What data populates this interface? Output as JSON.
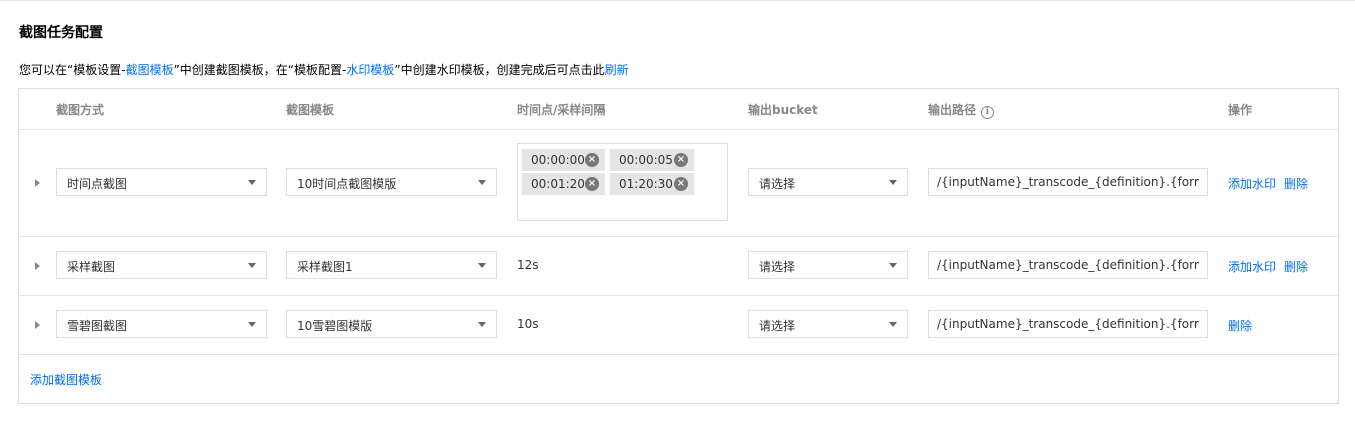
{
  "section": {
    "title": "截图任务配置"
  },
  "hint": {
    "p1": "您可以在“模板设置-",
    "link1": "截图模板",
    "p2": "”中创建截图模板，在“模板配置-",
    "link2": "水印模板",
    "p3": "”中创建水印模板，创建完成后可点击此",
    "refresh": "刷新"
  },
  "columns": {
    "method": "截图方式",
    "template": "截图模板",
    "interval": "时间点/采样间隔",
    "bucket": "输出bucket",
    "path": "输出路径",
    "actions": "操作"
  },
  "rows": [
    {
      "method": "时间点截图",
      "template": "10时间点截图模版",
      "tags": [
        "00:00:00",
        "00:00:05",
        "00:01:20",
        "01:20:30"
      ],
      "bucket": "请选择",
      "path": "/{inputName}_transcode_{definition}.{format}",
      "watermark": "添加水印",
      "delete": "删除"
    },
    {
      "method": "采样截图",
      "template": "采样截图1",
      "interval": "12s",
      "bucket": "请选择",
      "path": "/{inputName}_transcode_{definition}.{format}",
      "watermark": "添加水印",
      "delete": "删除"
    },
    {
      "method": "雪碧图截图",
      "template": "10雪碧图模版",
      "interval": "10s",
      "bucket": "请选择",
      "path": "/{inputName}_transcode_{definition}.{format}",
      "delete": "删除"
    }
  ],
  "add_template": "添加截图模板",
  "icons": {
    "info": "info-icon",
    "remove": "close-circle-icon",
    "expand": "caret-right-icon",
    "dropdown": "chevron-down-icon"
  },
  "colors": {
    "link": "#006eff",
    "tag_bg": "#e5e5e5",
    "border": "#dddddd"
  }
}
